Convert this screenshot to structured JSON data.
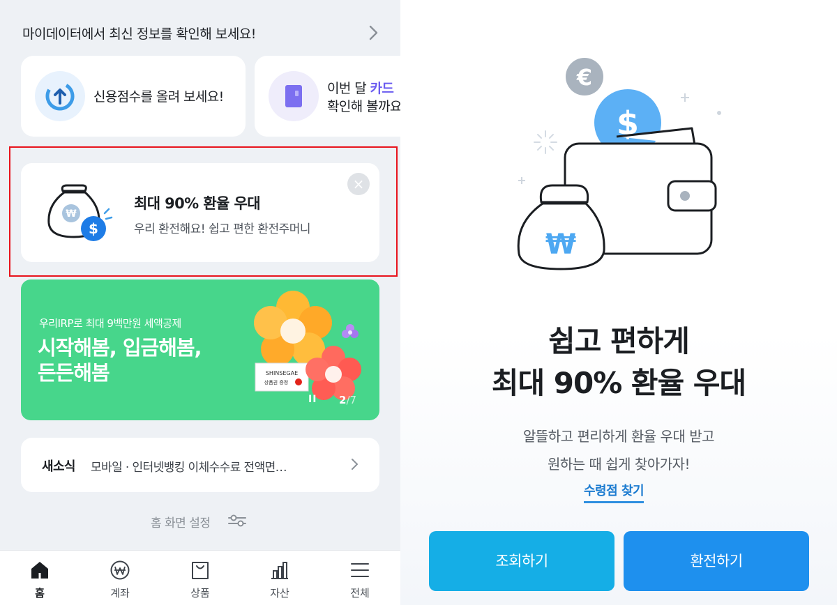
{
  "left": {
    "mydata_header": "마이데이터에서 최신 정보를 확인해 보세요!",
    "mini_cards": [
      {
        "text": "신용점수를 올려 보세요!",
        "icon": "credit-score-up-icon"
      },
      {
        "line1_prefix": "이번 달 ",
        "line1_accent": "카드 ",
        "line2": "확인해 볼까요",
        "icon": "card-icon"
      }
    ],
    "fx_card": {
      "title": "최대 90% 환율 우대",
      "subtitle": "우리 환전해요! 쉽고 편한 환전주머니",
      "close": "×"
    },
    "banner": {
      "subtitle": "우리IRP로 최대 9백만원 세액공제",
      "title_line1": "시작해봄, 입금해봄,",
      "title_line2": "든든해봄",
      "voucher_brand": "SHINSEGAE",
      "voucher_text": "상품권 증정",
      "pause": "II",
      "page_current": "2",
      "page_total": "/7"
    },
    "news": {
      "tag": "새소식",
      "text": "모바일 · 인터넷뱅킹 이체수수료 전액면…"
    },
    "home_settings": "홈 화면 설정",
    "tabs": [
      {
        "label": "홈",
        "icon": "home-icon",
        "active": true
      },
      {
        "label": "계좌",
        "icon": "won-coin-icon"
      },
      {
        "label": "상품",
        "icon": "shopping-bag-icon"
      },
      {
        "label": "자산",
        "icon": "bar-chart-icon"
      },
      {
        "label": "전체",
        "icon": "menu-icon"
      }
    ]
  },
  "right": {
    "hero_euro": "€",
    "hero_dollar": "$",
    "title_line1": "쉽고 편하게",
    "title_line2": "최대 90% 환율 우대",
    "sub_line1": "알뜰하고 편리하게 환율 우대 받고",
    "sub_line2": "원하는 때 쉽게 찾아가자!",
    "link": "수령점 찾기",
    "btn_inquiry": "조회하기",
    "btn_exchange": "환전하기"
  },
  "colors": {
    "highlight_red": "#e8131c",
    "banner_green": "#47d68b",
    "inquiry_blue": "#15aee6",
    "exchange_blue": "#1e90ee",
    "link_blue": "#1d7cd0"
  }
}
